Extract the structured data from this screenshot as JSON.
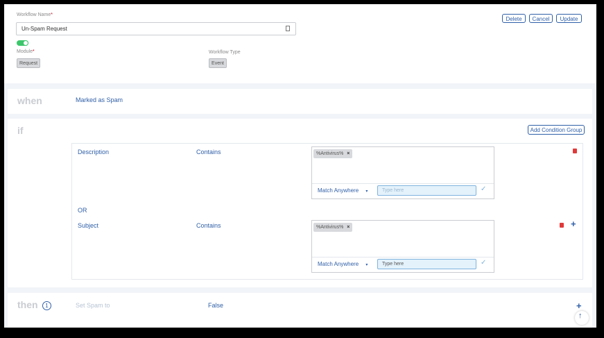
{
  "workflow": {
    "name_label": "Workflow Name",
    "required_mark": "*",
    "name_value": "Un-Spam Request",
    "module_label": "Module",
    "module_value": "Request",
    "type_label": "Workflow Type",
    "type_value": "Event"
  },
  "actions": {
    "delete": "Delete",
    "cancel": "Cancel",
    "update": "Update"
  },
  "when": {
    "keyword": "when",
    "event": "Marked as Spam"
  },
  "if": {
    "keyword": "if",
    "add_group": "Add Condition Group",
    "or_label": "OR",
    "conditions": [
      {
        "field": "Description",
        "operator": "Contains",
        "chip": "%Antivirus%",
        "match": "Match Anywhere",
        "placeholder": "Type here"
      },
      {
        "field": "Subject",
        "operator": "Contains",
        "chip": "%Antivirus%",
        "match": "Match Anywhere",
        "placeholder": "Type here"
      }
    ]
  },
  "then": {
    "keyword": "then",
    "count": "1",
    "action": "Set Spam to",
    "value": "False"
  },
  "colors": {
    "accent": "#2f5fa7",
    "danger": "#e03a3a",
    "toggle": "#3cc66b"
  }
}
